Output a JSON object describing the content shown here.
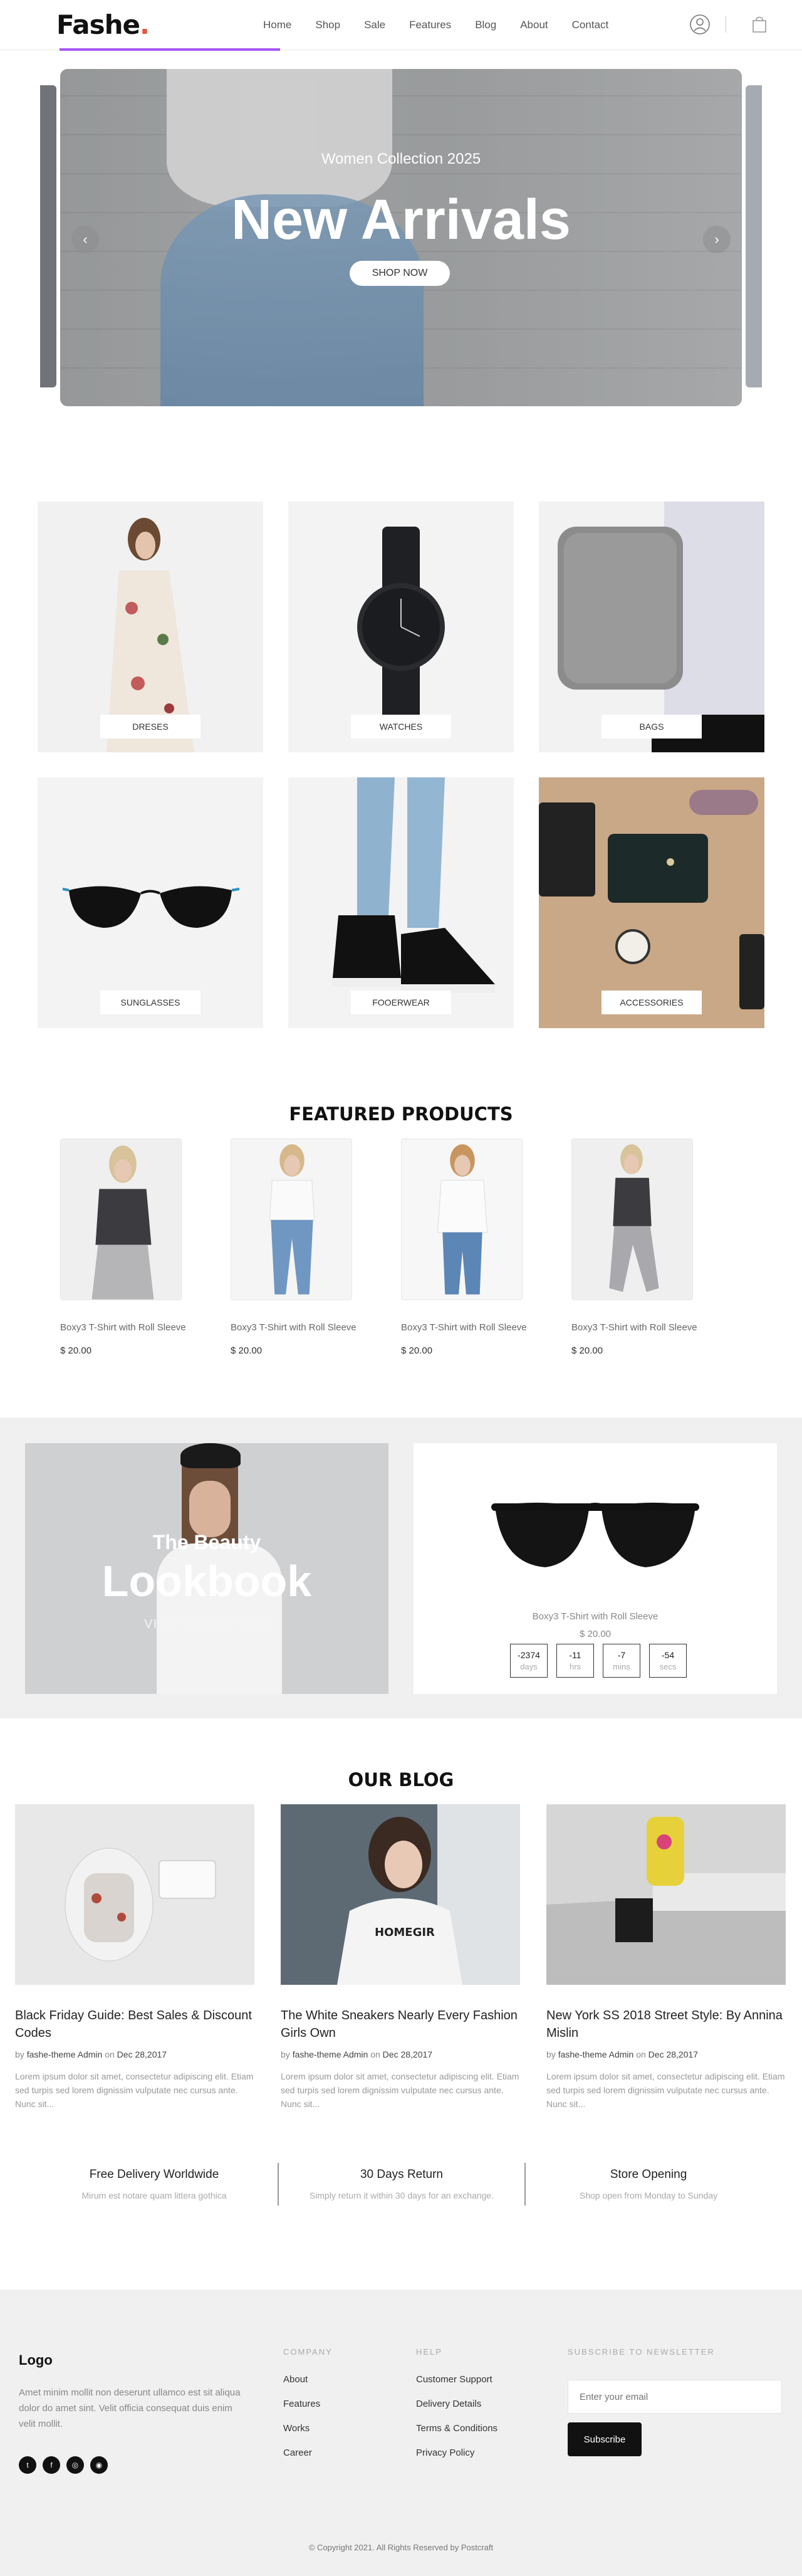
{
  "brand": {
    "name": "Fashe",
    "dot": ".",
    "accent": "#e65540"
  },
  "nav": {
    "items": [
      "Home",
      "Shop",
      "Sale",
      "Features",
      "Blog",
      "About",
      "Contact"
    ]
  },
  "header_icons": [
    "user-icon",
    "shopping-bag-icon"
  ],
  "hero": {
    "subtitle": "Women Collection 2025",
    "title": "New Arrivals",
    "button": "SHOP NOW",
    "prev": "‹",
    "next": "›"
  },
  "categories": [
    "DRESES",
    "WATCHES",
    "BAGS",
    "SUNGLASSES",
    "FOOERWEAR",
    "ACCESSORIES"
  ],
  "featured": {
    "title": "FEATURED PRODUCTS",
    "products": [
      {
        "name": "Boxy3 T-Shirt with Roll Sleeve",
        "price": "$ 20.00"
      },
      {
        "name": "Boxy3 T-Shirt with Roll Sleeve",
        "price": "$ 20.00"
      },
      {
        "name": "Boxy3 T-Shirt with Roll Sleeve",
        "price": "$ 20.00"
      },
      {
        "name": "Boxy3 T-Shirt with Roll Sleeve",
        "price": "$ 20.00"
      }
    ]
  },
  "lookbook": {
    "subtitle": "The Beauty",
    "title": "Lookbook",
    "link": "VIEW COLLECTION"
  },
  "deal": {
    "name": "Boxy3 T-Shirt with Roll Sleeve",
    "price": "$ 20.00",
    "countdown": [
      {
        "value": "-2374",
        "unit": "days"
      },
      {
        "value": "-11",
        "unit": "hrs"
      },
      {
        "value": "-7",
        "unit": "mins"
      },
      {
        "value": "-54",
        "unit": "secs"
      }
    ]
  },
  "blog": {
    "title": "OUR BLOG",
    "posts": [
      {
        "title": "Black Friday Guide: Best Sales & Discount Codes",
        "by": "by",
        "author": "fashe-theme Admin",
        "on": "on",
        "date": "Dec 28,2017",
        "excerpt": "Lorem ipsum dolor sit amet, consectetur adipiscing elit. Etiam sed turpis sed lorem dignissim vulputate nec cursus ante. Nunc sit..."
      },
      {
        "title": "The White Sneakers Nearly Every Fashion Girls Own",
        "by": "by",
        "author": "fashe-theme Admin",
        "on": "on",
        "date": "Dec 28,2017",
        "excerpt": "Lorem ipsum dolor sit amet, consectetur adipiscing elit. Etiam sed turpis sed lorem dignissim vulputate nec cursus ante. Nunc sit..."
      },
      {
        "title": "New York SS 2018 Street Style: By Annina Mislin",
        "by": "by",
        "author": "fashe-theme Admin",
        "on": "on",
        "date": "Dec 28,2017",
        "excerpt": "Lorem ipsum dolor sit amet, consectetur adipiscing elit. Etiam sed turpis sed lorem dignissim vulputate nec cursus ante. Nunc sit..."
      }
    ]
  },
  "features": [
    {
      "title": "Free Delivery Worldwide",
      "text": "Mirum est notare quam littera gothica"
    },
    {
      "title": "30 Days Return",
      "text": "Simply return it within 30 days for an exchange."
    },
    {
      "title": "Store Opening",
      "text": "Shop open from Monday to Sunday"
    }
  ],
  "footer": {
    "logo": "Logo",
    "text": "Amet minim mollit non deserunt ullamco est sit aliqua dolor do amet sint. Velit officia consequat duis enim velit mollit.",
    "socials": [
      {
        "icon": "twitter-icon",
        "glyph": "t"
      },
      {
        "icon": "facebook-icon",
        "glyph": "f"
      },
      {
        "icon": "instagram-icon",
        "glyph": "◎"
      },
      {
        "icon": "github-icon",
        "glyph": "◉"
      }
    ],
    "company": {
      "title": "COMPANY",
      "links": [
        "About",
        "Features",
        "Works",
        "Career"
      ]
    },
    "help": {
      "title": "HELP",
      "links": [
        "Customer Support",
        "Delivery Details",
        "Terms & Conditions",
        "Privacy Policy"
      ]
    },
    "newsletter": {
      "title": "SUBSCRIBE TO NEWSLETTER",
      "placeholder": "Enter your email",
      "button": "Subscribe"
    },
    "copyright": "© Copyright 2021. All Rights Reserved by Postcraft"
  },
  "colors": {
    "underline": "#a855f7",
    "footer_bg": "#f0f0f0",
    "band_bg": "#f0f0f0"
  }
}
